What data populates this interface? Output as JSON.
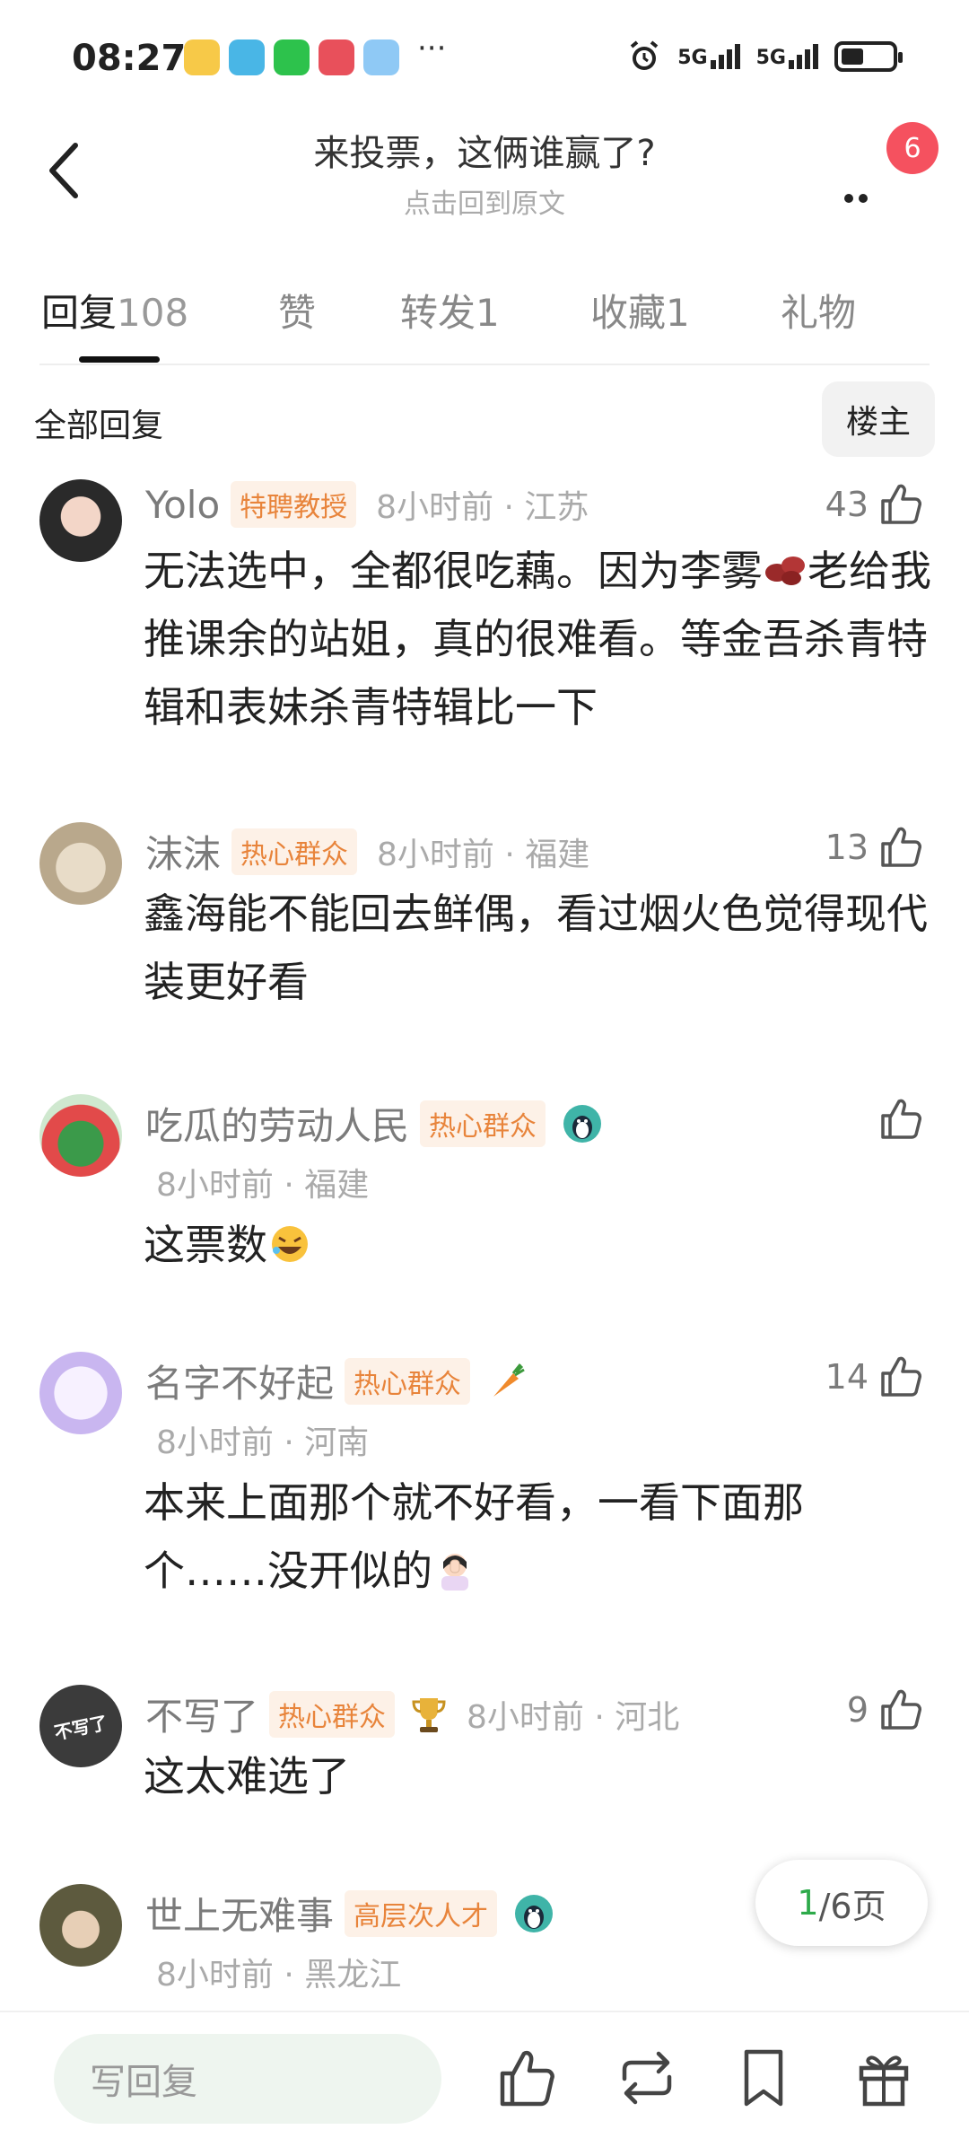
{
  "status_bar": {
    "time": "08:27",
    "more": "···",
    "signal1": "5G",
    "signal2": "5G",
    "battery_level": 0.45
  },
  "header": {
    "title": "来投票，这俩谁赢了?",
    "subtitle": "点击回到原文",
    "badge": "6"
  },
  "tabs": [
    {
      "label": "回复",
      "count": "108"
    },
    {
      "label": "赞",
      "count": ""
    },
    {
      "label": "转发",
      "count": "1"
    },
    {
      "label": "收藏",
      "count": "1"
    },
    {
      "label": "礼物",
      "count": ""
    }
  ],
  "section": {
    "label": "全部回复",
    "owner_button": "楼主"
  },
  "comments": [
    {
      "name": "Yolo",
      "tag": "特聘教授",
      "time": "8小时前 · 江苏",
      "likes": "43",
      "text_a": "无法选中，全都很吃藕。因为李雾",
      "text_b": "老给我推课余的站姐，真的很难看。等金吾杀青特辑和表妹杀青特辑比一下",
      "emoji": "beans"
    },
    {
      "name": "沫沫",
      "tag": "热心群众",
      "time": "8小时前 · 福建",
      "likes": "13",
      "text": "鑫海能不能回去鲜偶，看过烟火色觉得现代装更好看"
    },
    {
      "name": "吃瓜的劳动人民",
      "tag": "热心群众",
      "time": "8小时前 · 福建",
      "likes": "",
      "text": "这票数",
      "emoji": "rofl"
    },
    {
      "name": "名字不好起",
      "tag": "热心群众",
      "time": "8小时前 · 河南",
      "likes": "14",
      "text": "本来上面那个就不好看，一看下面那个……没开似的",
      "emoji": "facepalm"
    },
    {
      "name": "不写了",
      "tag": "热心群众",
      "time": "8小时前 · 河北",
      "likes": "9",
      "text": "这太难选了",
      "avatar_text": "不写了"
    },
    {
      "name": "世上无难事",
      "tag": "高层次人才",
      "time": "8小时前 · 黑龙江",
      "likes": "",
      "text": ""
    }
  ],
  "pager": {
    "current": "1",
    "total": "/6页"
  },
  "bottom_bar": {
    "reply_placeholder": "写回复"
  },
  "colors": {
    "accent_green": "#2eaa4a",
    "tag_orange": "#e8843b",
    "badge_red": "#f5515f"
  }
}
